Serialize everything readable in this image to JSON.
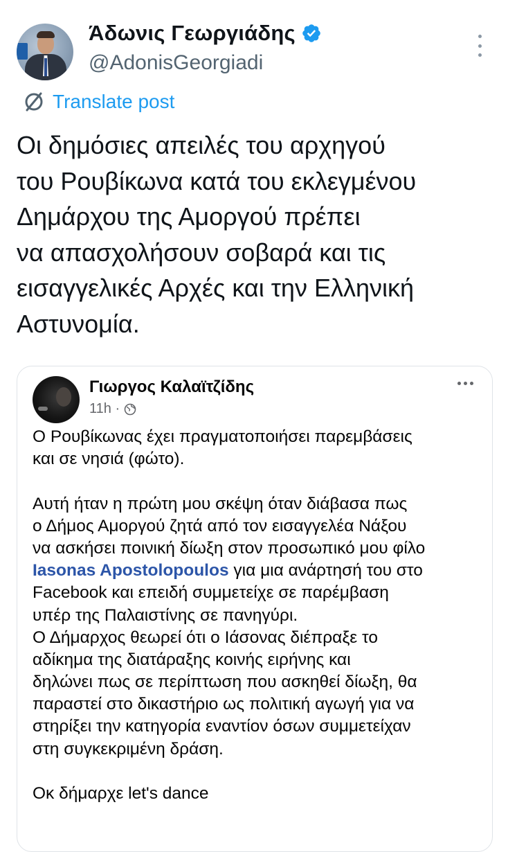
{
  "tweet": {
    "author_name": "Άδωνις Γεωργιάδης",
    "author_handle": "@AdonisGeorgiadi",
    "translate_label": "Translate post",
    "text": "Οι δημόσιες απειλές του αρχηγού\nτου Ρουβίκωνα κατά του εκλεγμένου\nΔημάρχου της Αμοργού πρέπει\nνα απασχολήσουν σοβαρά και τις\nεισαγγελικές Αρχές και την Ελληνική\nΑστυνομία.",
    "verified_color": "#1d9bf0",
    "translate_icon": "translate-icon",
    "more_icon": "more-vertical-icon"
  },
  "embedded_post": {
    "author_name": "Γιωργος Καλαϊτζίδης",
    "time": "11h ·",
    "privacy_icon": "globe-icon",
    "para1": [
      "Ο Ρουβίκωνας έχει πραγματοποιήσει παρεμβάσεις",
      "και σε νησιά (φώτο)."
    ],
    "para2": [
      "Αυτή ήταν η πρώτη μου σκέψη όταν διάβασα πως",
      "ο Δήμος Αμοργού ζητά από τον εισαγγελέα Νάξου",
      "να ασκήσει ποινική δίωξη στον προσωπικό μου φίλο"
    ],
    "mention": "Iasonas Apostolopoulos",
    "mention_suffix": " για μια ανάρτησή του στο",
    "para2_rest": [
      "Facebook και επειδή συμμετείχε σε παρέμβαση",
      "υπέρ της Παλαιστίνης σε πανηγύρι.",
      "Ο Δήμαρχος θεωρεί ότι ο Ιάσονας διέπραξε το",
      "αδίκημα της διατάραξης κοινής ειρήνης και",
      "δηλώνει πως σε περίπτωση που ασκηθεί δίωξη, θα",
      "παραστεί στο δικαστήριο ως πολιτική αγωγή για να",
      "στηρίξει την κατηγορία εναντίον όσων συμμετείχαν",
      "στη συγκεκριμένη δράση."
    ],
    "closing": "Οκ δήμαρχε let's dance",
    "mention_color": "#2c55a8"
  }
}
